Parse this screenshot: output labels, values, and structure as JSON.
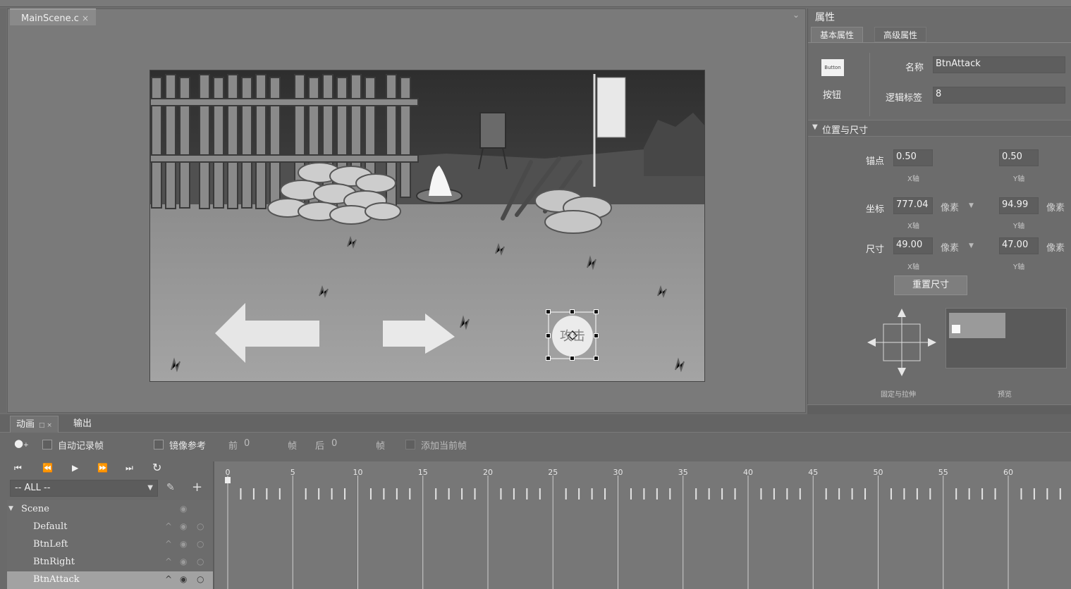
{
  "editor": {
    "doc_tab": "MainScene.c",
    "doc_tab_close": "×"
  },
  "scene": {
    "button_text": "攻击",
    "colors": {
      "sky": "#3d3d3d",
      "ground": "#9a9a9a",
      "arrow": "#e6e6e6"
    }
  },
  "properties": {
    "title": "属性",
    "tabs": [
      "基本属性",
      "高级属性"
    ],
    "thumb_text": "Button",
    "component_type": "按钮",
    "name_label": "名称",
    "name_value": "BtnAttack",
    "tag_label": "逻辑标签",
    "tag_value": "8",
    "section_title": "位置与尺寸",
    "anchor_label": "锚点",
    "anchor_x": "0.50",
    "anchor_y": "0.50",
    "pos_label": "坐标",
    "pos_x": "777.04",
    "pos_y": "94.99",
    "size_label": "尺寸",
    "size_w": "49.00",
    "size_h": "47.00",
    "unit": "像素",
    "x_axis": "X轴",
    "y_axis": "Y轴",
    "reset_label": "重置尺寸",
    "fix_stretch_label": "固定与拉伸",
    "preview_label": "预览"
  },
  "animation": {
    "tabs": {
      "anim": "动画",
      "output": "输出",
      "anim_mini": "□ ×"
    },
    "auto_record": "自动记录帧",
    "mirror_ref": "镜像参考",
    "before_label": "前",
    "before_value": "0",
    "frame_unit": "帧",
    "after_label": "后",
    "after_value": "0",
    "add_frame": "添加当前帧",
    "filter": "-- ALL --",
    "tree": {
      "root": "Scene",
      "items": [
        "Default",
        "BtnLeft",
        "BtnRight",
        "BtnAttack"
      ]
    },
    "timeline_ticks": [
      "0",
      "5",
      "10",
      "15",
      "20",
      "25",
      "30",
      "35",
      "40",
      "45",
      "50",
      "55",
      "60"
    ],
    "playback_icons": [
      "first-frame",
      "prev-frame",
      "play",
      "next-frame",
      "last-frame",
      "loop"
    ]
  }
}
